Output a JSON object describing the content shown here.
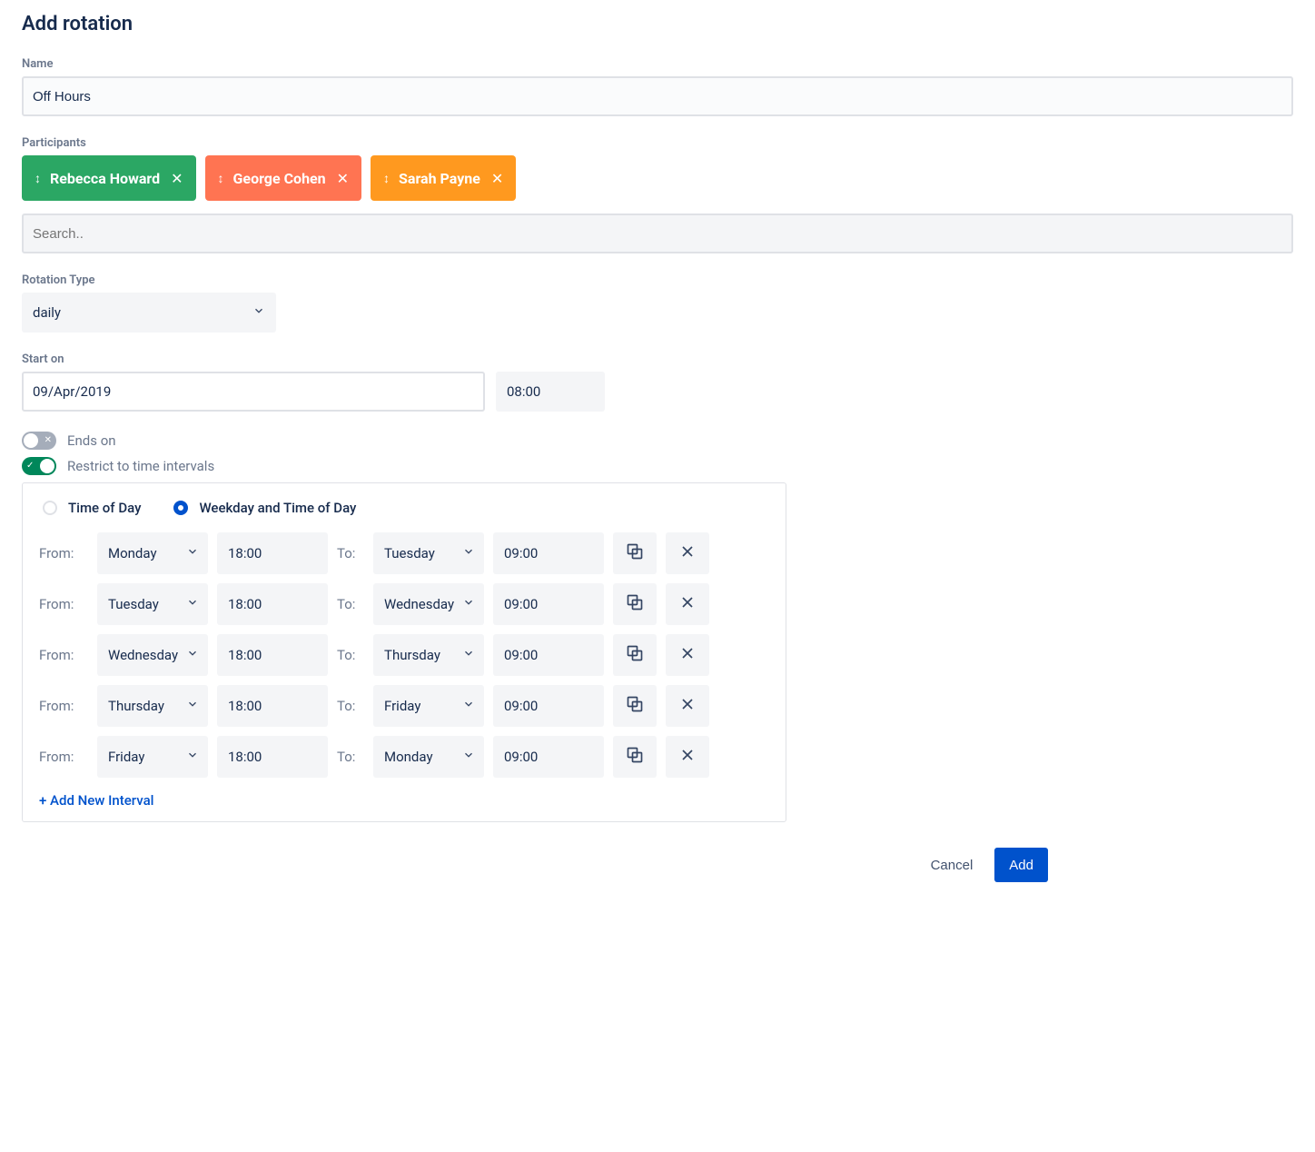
{
  "title": "Add rotation",
  "name": {
    "label": "Name",
    "value": "Off Hours"
  },
  "participants": {
    "label": "Participants",
    "chips": [
      {
        "name": "Rebecca Howard",
        "color": "green"
      },
      {
        "name": "George Cohen",
        "color": "orange-red"
      },
      {
        "name": "Sarah Payne",
        "color": "orange"
      }
    ],
    "search_placeholder": "Search.."
  },
  "rotation_type": {
    "label": "Rotation Type",
    "value": "daily"
  },
  "start_on": {
    "label": "Start on",
    "date": "09/Apr/2019",
    "time": "08:00"
  },
  "toggles": {
    "ends_on": {
      "label": "Ends on",
      "on": false
    },
    "restrict": {
      "label": "Restrict to time intervals",
      "on": true
    }
  },
  "interval_mode": {
    "options": [
      "Time of Day",
      "Weekday and Time of Day"
    ],
    "selected": 1
  },
  "interval_labels": {
    "from": "From:",
    "to": "To:",
    "add_new": "+ Add New Interval"
  },
  "intervals": [
    {
      "from_day": "Monday",
      "from_time": "18:00",
      "to_day": "Tuesday",
      "to_time": "09:00"
    },
    {
      "from_day": "Tuesday",
      "from_time": "18:00",
      "to_day": "Wednesday",
      "to_time": "09:00"
    },
    {
      "from_day": "Wednesday",
      "from_time": "18:00",
      "to_day": "Thursday",
      "to_time": "09:00"
    },
    {
      "from_day": "Thursday",
      "from_time": "18:00",
      "to_day": "Friday",
      "to_time": "09:00"
    },
    {
      "from_day": "Friday",
      "from_time": "18:00",
      "to_day": "Monday",
      "to_time": "09:00"
    }
  ],
  "footer": {
    "cancel": "Cancel",
    "add": "Add"
  }
}
